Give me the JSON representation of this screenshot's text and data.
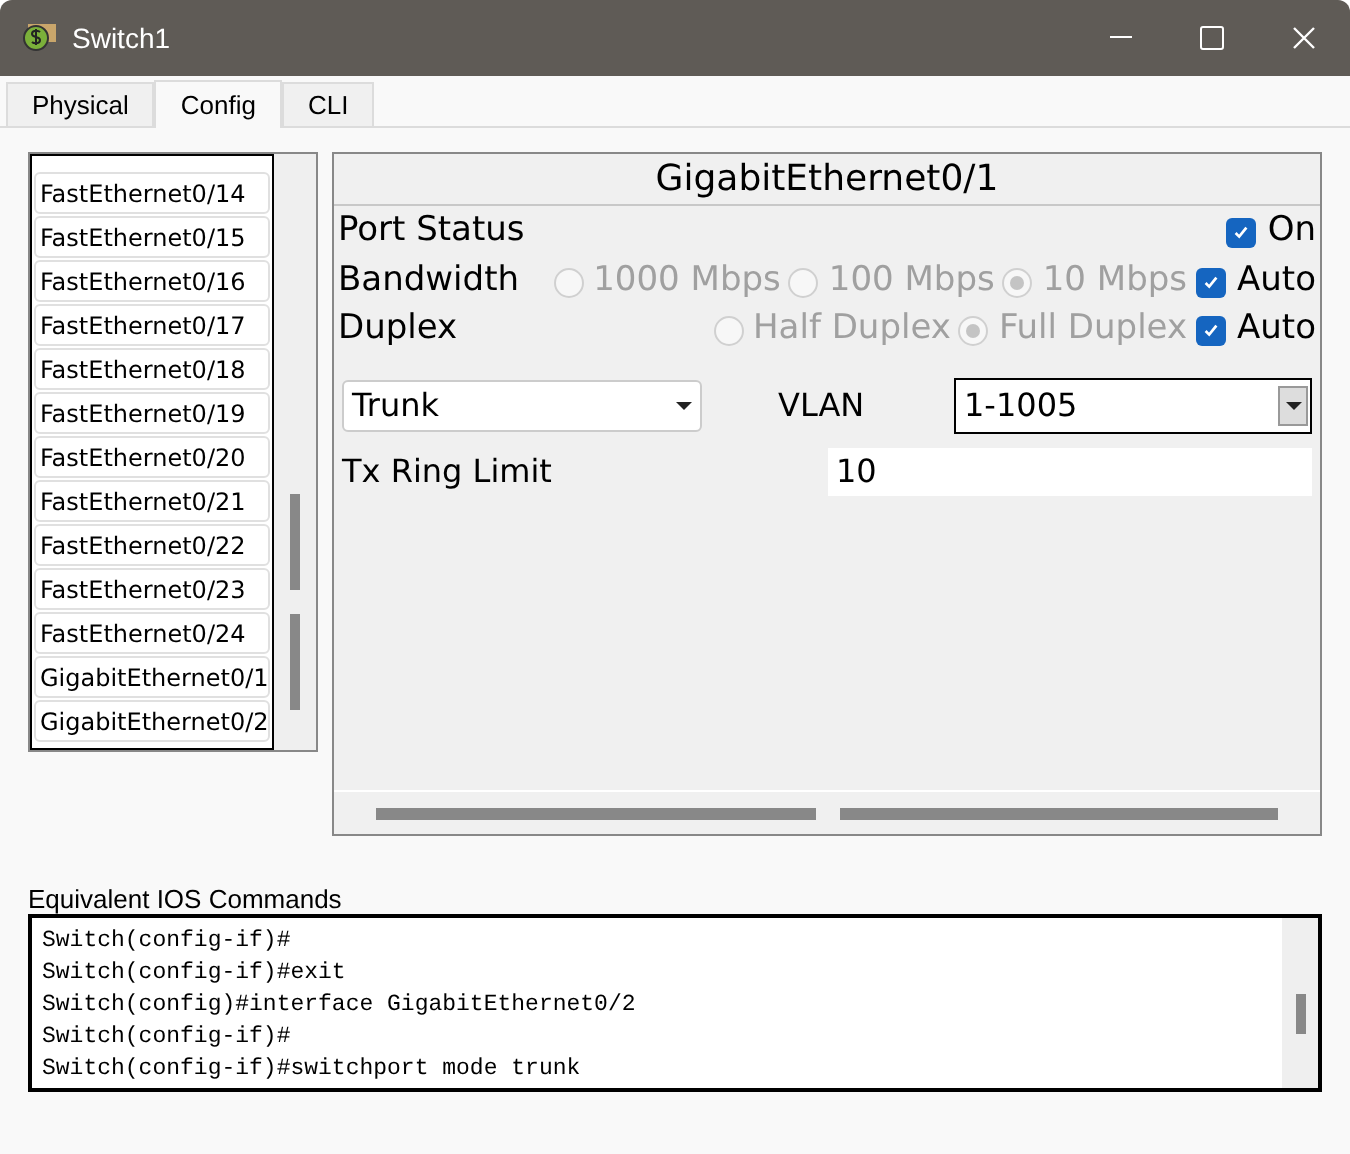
{
  "window": {
    "title": "Switch1"
  },
  "tabs": [
    {
      "label": "Physical",
      "selected": false
    },
    {
      "label": "Config",
      "selected": true
    },
    {
      "label": "CLI",
      "selected": false
    }
  ],
  "port_list": {
    "items": [
      {
        "label": "FastEthernet0/14",
        "selected": false
      },
      {
        "label": "FastEthernet0/15",
        "selected": false
      },
      {
        "label": "FastEthernet0/16",
        "selected": false
      },
      {
        "label": "FastEthernet0/17",
        "selected": false
      },
      {
        "label": "FastEthernet0/18",
        "selected": false
      },
      {
        "label": "FastEthernet0/19",
        "selected": false
      },
      {
        "label": "FastEthernet0/20",
        "selected": false
      },
      {
        "label": "FastEthernet0/21",
        "selected": false
      },
      {
        "label": "FastEthernet0/22",
        "selected": false
      },
      {
        "label": "FastEthernet0/23",
        "selected": false
      },
      {
        "label": "FastEthernet0/24",
        "selected": false
      },
      {
        "label": "GigabitEthernet0/1",
        "selected": false
      },
      {
        "label": "GigabitEthernet0/2",
        "selected": false
      }
    ]
  },
  "port": {
    "title": "GigabitEthernet0/1",
    "port_status": {
      "label": "Port Status",
      "on_label": "On",
      "on": true
    },
    "bandwidth": {
      "label": "Bandwidth",
      "disabled": true,
      "options": [
        {
          "label": "1000 Mbps",
          "selected": false
        },
        {
          "label": "100 Mbps",
          "selected": false
        },
        {
          "label": "10 Mbps",
          "selected": true
        }
      ],
      "auto": {
        "label": "Auto",
        "checked": true
      }
    },
    "duplex": {
      "label": "Duplex",
      "disabled": true,
      "options": [
        {
          "label": "Half Duplex",
          "selected": false
        },
        {
          "label": "Full Duplex",
          "selected": true
        }
      ],
      "auto": {
        "label": "Auto",
        "checked": true
      }
    },
    "mode": {
      "value": "Trunk"
    },
    "vlan": {
      "label": "VLAN",
      "value": "1-1005"
    },
    "tx_ring": {
      "label": "Tx Ring Limit",
      "value": "10"
    }
  },
  "ios": {
    "label": "Equivalent IOS Commands",
    "lines": [
      "Switch(config-if)#",
      "Switch(config-if)#exit",
      "Switch(config)#interface GigabitEthernet0/2",
      "Switch(config-if)#",
      "Switch(config-if)#switchport mode trunk"
    ]
  }
}
